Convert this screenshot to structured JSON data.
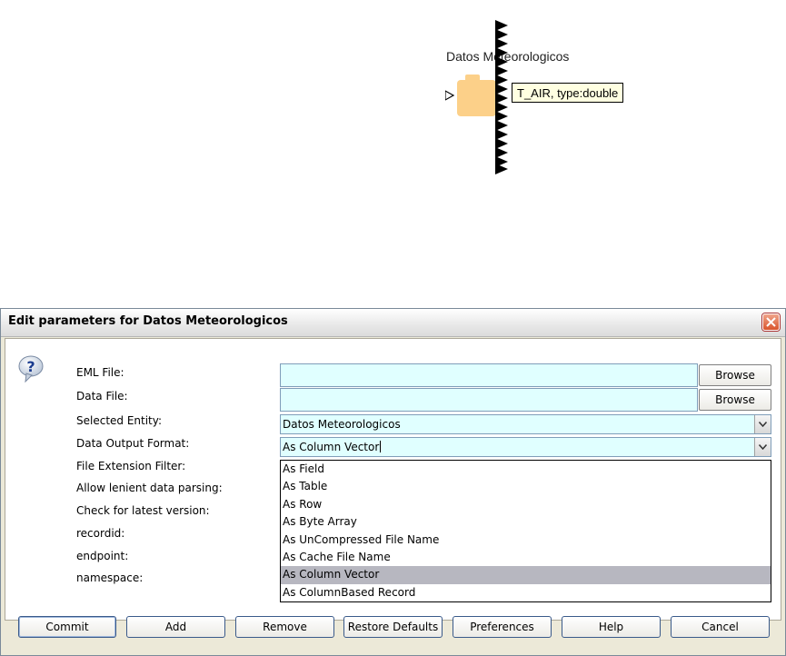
{
  "canvas": {
    "actor_title": "Datos Meteorologicos",
    "actor_icon": "folder-icon",
    "port_icon": "triangle-port-icon",
    "tooltip": "T_AIR, type:double"
  },
  "dialog": {
    "title": "Edit parameters for Datos Meteorologicos",
    "close_icon": "close-icon",
    "help_icon": "question-icon",
    "fields": [
      {
        "label": "EML File:",
        "value": "",
        "button": "Browse"
      },
      {
        "label": "Data File:",
        "value": "",
        "button": "Browse"
      },
      {
        "label": "Selected Entity:",
        "value": "Datos Meteorologicos"
      },
      {
        "label": "Data Output Format:",
        "value": "As Column Vector"
      },
      {
        "label": "File Extension Filter:"
      },
      {
        "label": "Allow lenient data parsing:"
      },
      {
        "label": "Check for latest version:"
      },
      {
        "label": "recordid:"
      },
      {
        "label": "endpoint:"
      },
      {
        "label": "namespace:"
      }
    ],
    "dropdown_options": [
      "As Field",
      "As Table",
      "As Row",
      "As Byte Array",
      "As UnCompressed File Name",
      "As Cache File Name",
      "As Column Vector",
      "As ColumnBased Record"
    ],
    "selected_option_index": 6,
    "buttons": {
      "commit": "Commit",
      "add": "Add",
      "remove": "Remove",
      "restore": "Restore Defaults",
      "preferences": "Preferences",
      "help": "Help",
      "cancel": "Cancel"
    }
  },
  "colors": {
    "field_bg": "#e0ffff",
    "folder": "#fcd089",
    "tooltip_bg": "#ffffe1",
    "selected_item": "#b7b7c0",
    "dialog_bg": "#ece9d8"
  }
}
